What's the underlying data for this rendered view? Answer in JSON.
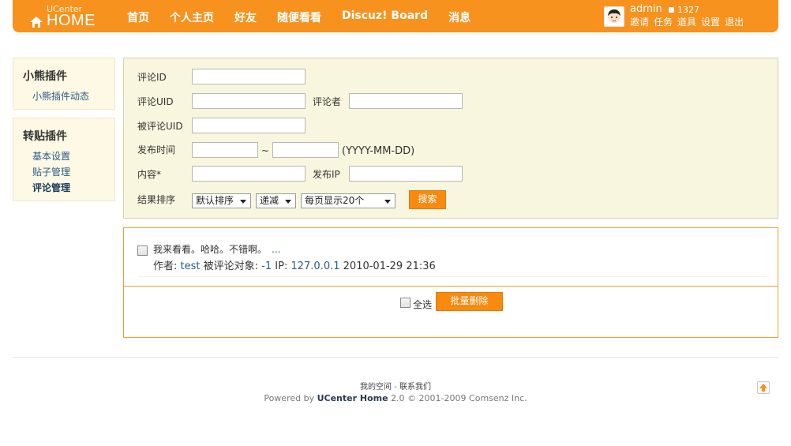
{
  "header": {
    "logo_small": "UCenter",
    "logo_big": "HOME",
    "nav": [
      "首页",
      "个人主页",
      "好友",
      "随便看看",
      "Discuz! Board",
      "消息"
    ],
    "username": "admin",
    "credit": "1327",
    "user_menu": [
      "邀请",
      "任务",
      "道具",
      "设置",
      "退出"
    ]
  },
  "sidebar": {
    "group1_title": "小熊插件",
    "group1_items": [
      "小熊插件动态"
    ],
    "group2_title": "转贴插件",
    "group2_items": [
      "基本设置",
      "贴子管理",
      "评论管理"
    ]
  },
  "search": {
    "label_cid": "评论ID",
    "label_uid": "评论UID",
    "label_author": "评论者",
    "label_target_uid": "被评论UID",
    "label_time": "发布时间",
    "time_sep": "~",
    "time_hint": "(YYYY-MM-DD)",
    "label_content": "内容*",
    "label_ip": "发布IP",
    "label_order": "结果排序",
    "order_select": "默认排序",
    "direction_select": "递减",
    "perpage_select": "每页显示20个",
    "submit": "搜索"
  },
  "results": {
    "message": "我来看看。哈哈。不错啊。",
    "more": "...",
    "author_label": "作者:",
    "author": "test",
    "target_label": "被评论对象:",
    "target": "-1",
    "ip_label": "IP:",
    "ip": "127.0.0.1",
    "datetime": "2010-01-29 21:36",
    "select_all": "全选",
    "batch_delete": "批量删除"
  },
  "footer": {
    "my_space": "我的空间",
    "dash": "-",
    "contact": "联系我们",
    "powered_prefix": "Powered by",
    "product": "UCenter Home",
    "version": "2.0",
    "copyright": "© 2001-2009",
    "company": "Comsenz Inc."
  },
  "icons": [
    "home-icon",
    "avatar-icon",
    "coin-icon",
    "checkbox-icon",
    "back-to-top-icon"
  ],
  "colors": {
    "accent": "#f7921e",
    "sidebar_bg": "#fdf9e4",
    "link": "#2b5a88"
  }
}
